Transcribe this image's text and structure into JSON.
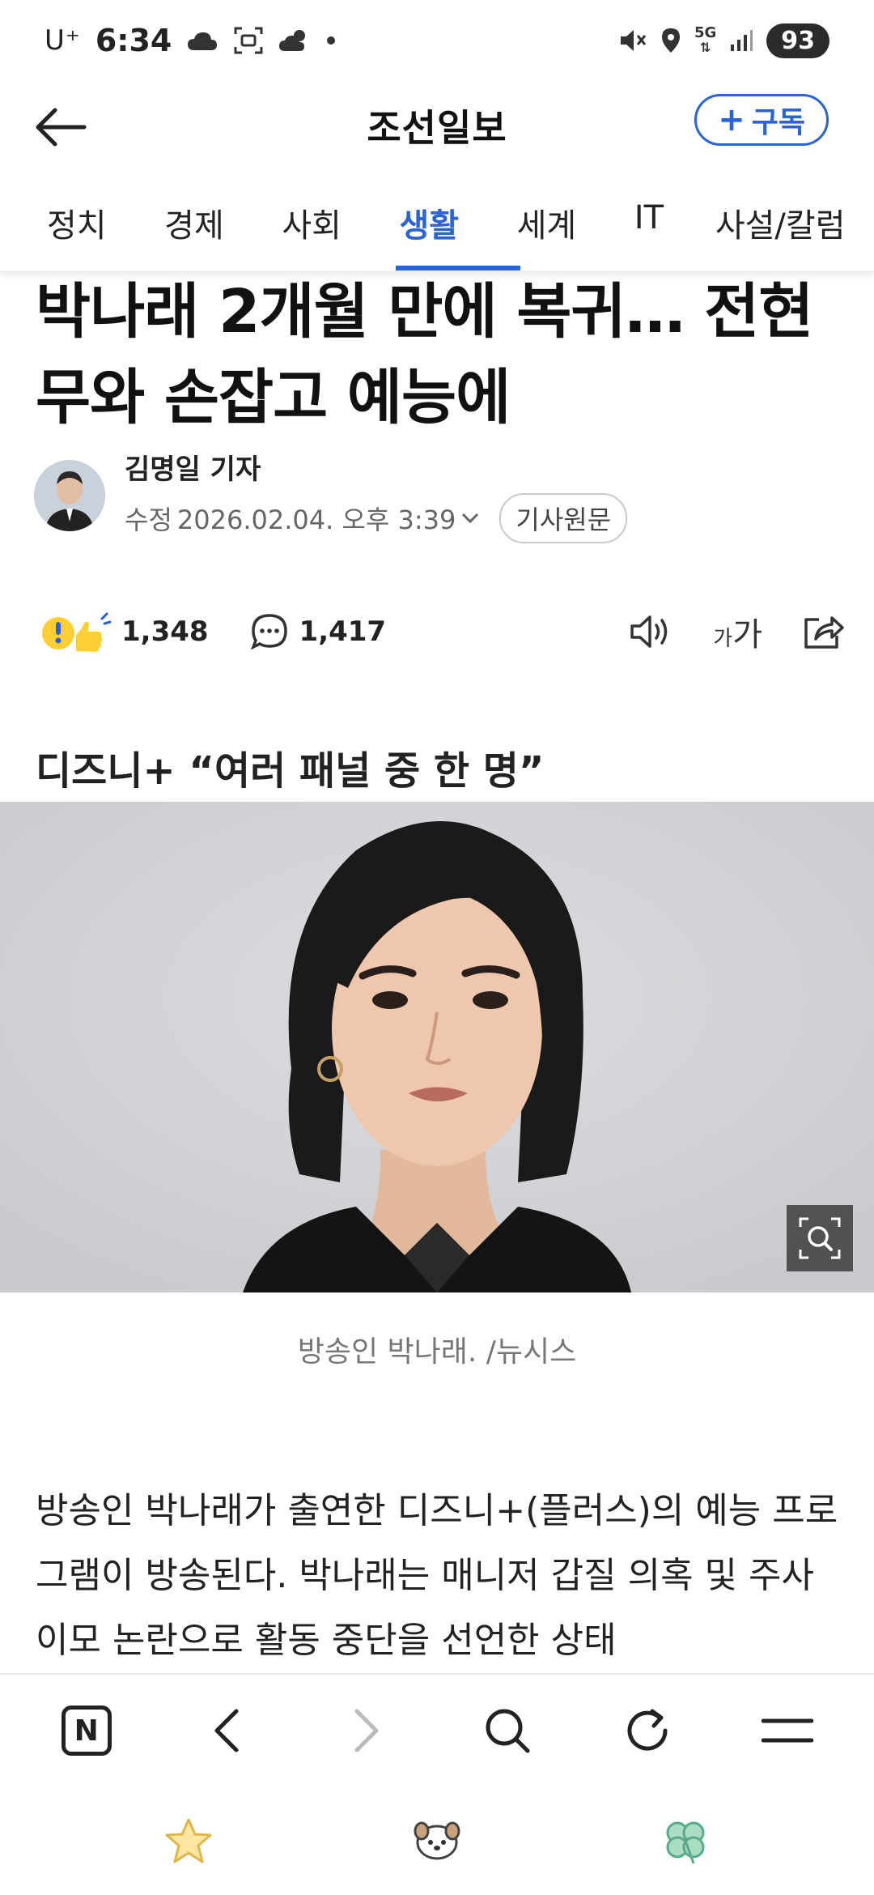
{
  "status_bar": {
    "carrier": "U⁺",
    "time": "6:34",
    "network": "5G",
    "battery": "93"
  },
  "header": {
    "brand": "조선일보",
    "subscribe_label": "구독",
    "subscribe_plus": "+"
  },
  "tabs": [
    {
      "label": "정치",
      "active": false
    },
    {
      "label": "경제",
      "active": false
    },
    {
      "label": "사회",
      "active": false
    },
    {
      "label": "생활",
      "active": true
    },
    {
      "label": "세계",
      "active": false
    },
    {
      "label": "IT",
      "active": false
    },
    {
      "label": "사설/칼럼",
      "active": false
    }
  ],
  "article": {
    "headline": "박나래 2개월 만에 복귀… 전현무와 손잡고 예능에",
    "author": "김명일 기자",
    "modified_label": "수정",
    "modified_date": "2026.02.04. 오후 3:39",
    "original_label": "기사원문",
    "reaction_count": "1,348",
    "comment_count": "1,417",
    "font_size_small": "가",
    "font_size_large": "가",
    "subheading": "디즈니+ “여러 패널 중 한 명”",
    "caption": "방송인 박나래. /뉴시스",
    "body": "방송인 박나래가 출연한 디즈니+(플러스)의 예능 프로그램이 방송된다. 박나래는 매니저 갑질 의혹 및 주사 이모 논란으로 활동 중단을 선언한 상태"
  },
  "browser": {
    "n_label": "N"
  },
  "colors": {
    "accent": "#2a63d6",
    "text": "#111111",
    "muted": "#777777"
  }
}
